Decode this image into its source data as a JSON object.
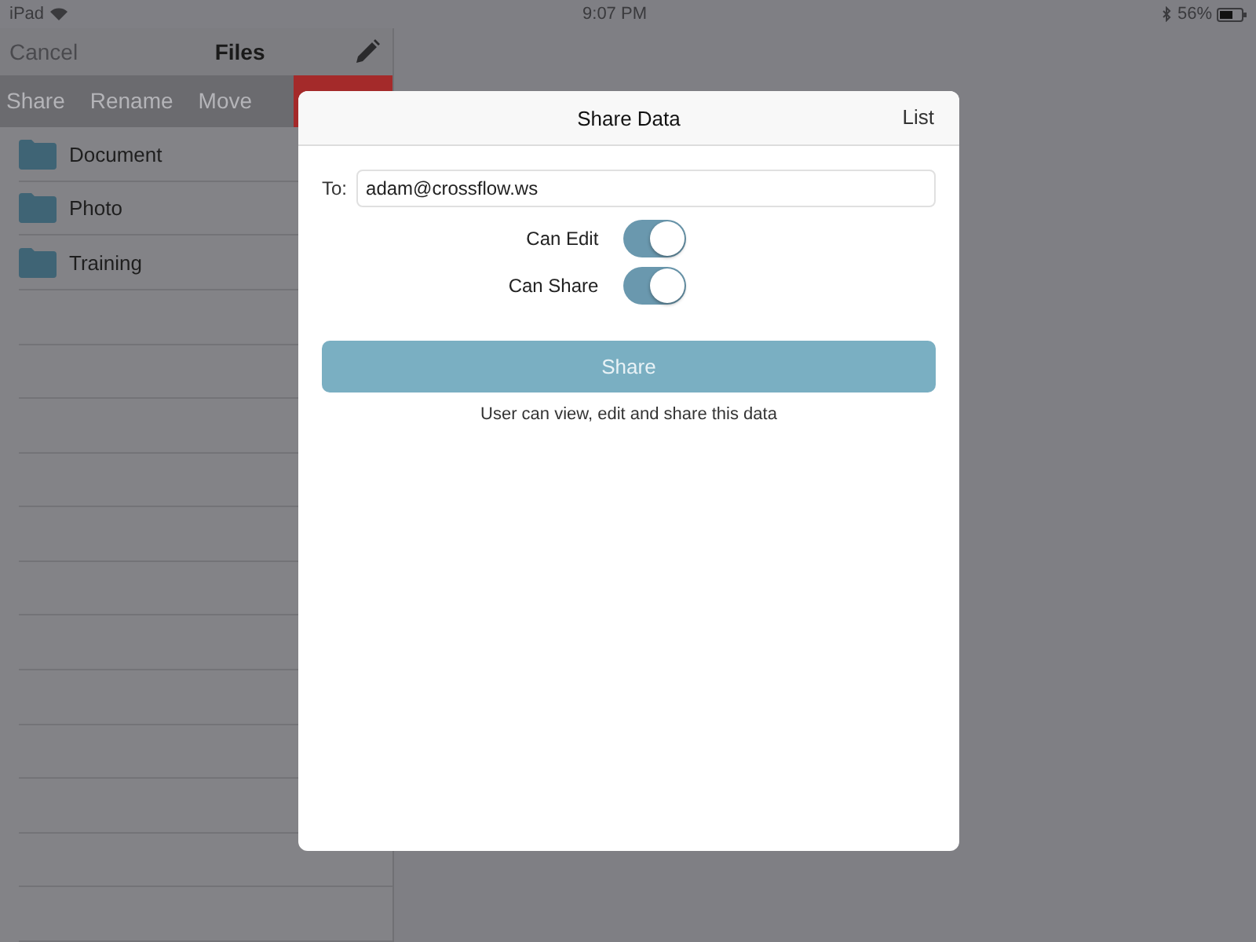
{
  "status_bar": {
    "device": "iPad",
    "time": "9:07 PM",
    "battery": "56%"
  },
  "files_panel": {
    "cancel": "Cancel",
    "title": "Files",
    "actions": [
      "Share",
      "Rename",
      "Move"
    ],
    "items": [
      {
        "name": "Document"
      },
      {
        "name": "Photo"
      },
      {
        "name": "Training"
      }
    ]
  },
  "dialog": {
    "title": "Share Data",
    "list_button": "List",
    "to_label": "To:",
    "to_value": "adam@crossflow.ws",
    "toggles": [
      {
        "label": "Can Edit",
        "on": true
      },
      {
        "label": "Can Share",
        "on": true
      }
    ],
    "share_button": "Share",
    "note": "User can view, edit and share this data"
  }
}
